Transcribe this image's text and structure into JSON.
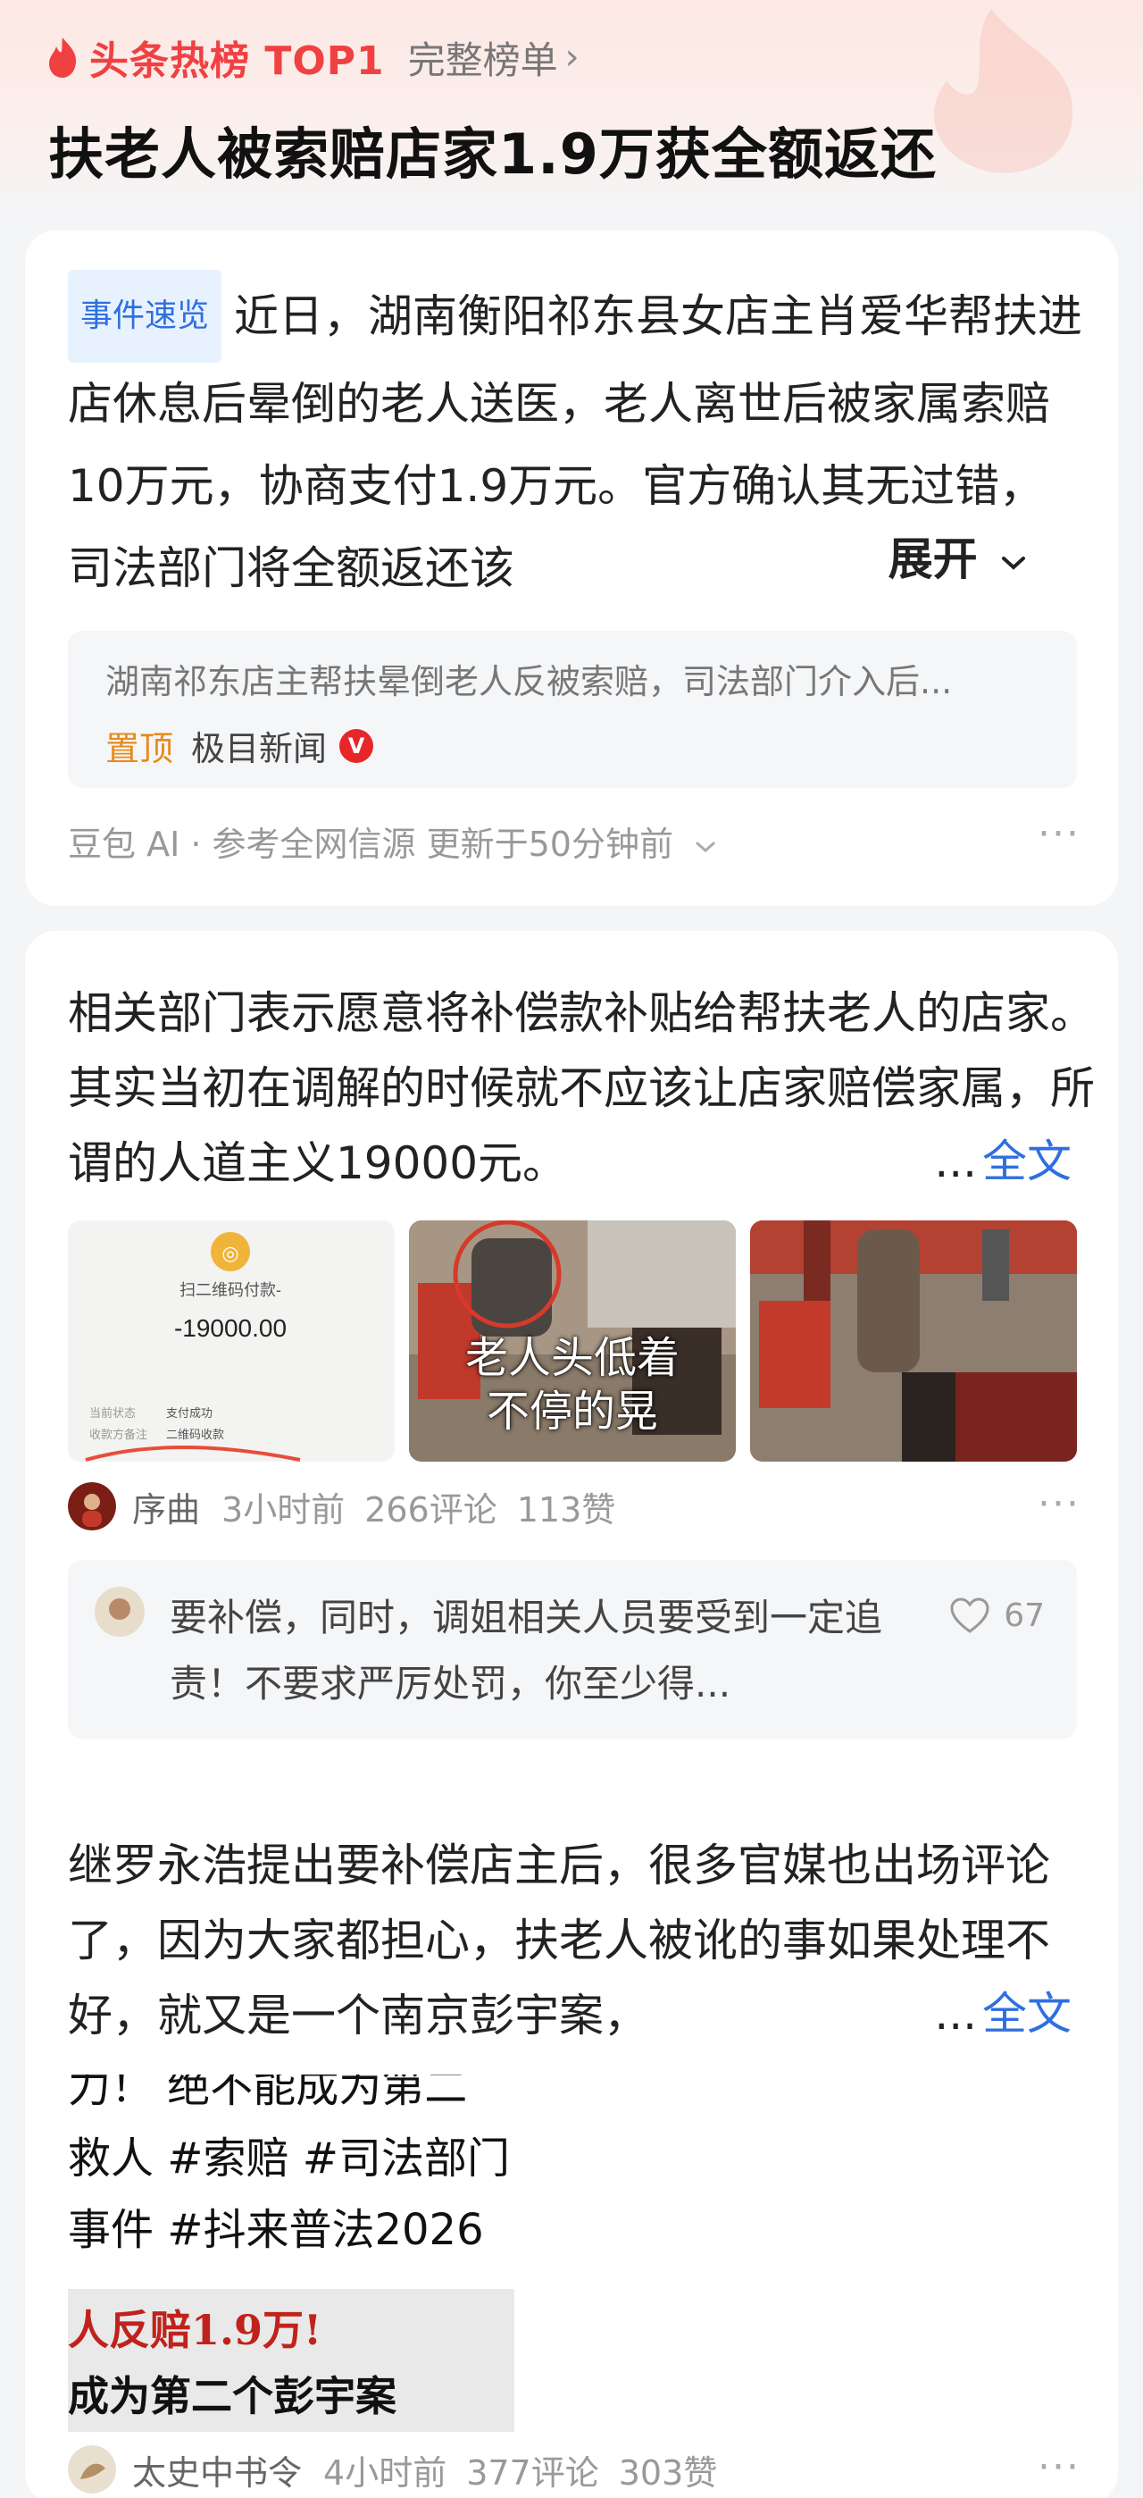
{
  "header": {
    "hot_label": "头条热榜 TOP1",
    "list_link": "完整榜单",
    "chevron": "›",
    "headline": "扶老人被索赔店家1.9万获全额返还"
  },
  "summary_card": {
    "tag": "事件速览",
    "text": "近日，湖南衡阳祁东县女店主肖爱华帮扶进店休息后晕倒的老人送医，老人离世后被家属索赔10万元，协商支付1.9万元。官方确认其无过错，司法部门将全额返还该",
    "expand": "展开",
    "expand_icon": "chevron-down",
    "source_title": "湖南祁东店主帮扶晕倒老人反被索赔，司法部门介入后...",
    "pinned": "置顶",
    "source_name": "极目新闻",
    "verified": "V",
    "ai_line": "豆包 AI · 参考全网信源 更新于50分钟前",
    "more": "···"
  },
  "post1": {
    "text": "相关部门表示愿意将补偿款补贴给帮扶老人的店家。 其实当初在调解的时候就不应该让店家赔偿家属，所谓的人道主义19000元。",
    "ellipsis": "...",
    "fulltext": "全文",
    "img1": {
      "title": "扫二维码付款-",
      "amount": "-19000.00",
      "row1_label": "当前状态",
      "row1_value": "支付成功",
      "row2_label": "收款方备注",
      "row2_value": "二维码收款"
    },
    "img2_caption_1": "老人头低着",
    "img2_caption_2": "不停的晃",
    "author": "序曲",
    "time": "3小时前",
    "comments": "266评论",
    "likes": "113赞",
    "more": "···",
    "comment_text": "要补偿，同时，调姐相关人员要受到一定追责！不要求严厉处罚，你至少得...",
    "comment_likes": "67"
  },
  "post2": {
    "text": "继罗永浩提出要补偿店主后，很多官媒也出场评论了，因为大家都担心，扶老人被讹的事如果处理不好，就又是一个南京彭宇案，",
    "ellipsis": "...",
    "fulltext": "全文",
    "img_line1": "力！ 绝不能成为第二",
    "img_line2": "救人 #索赔 #司法部门",
    "img_line3": "事件 #抖来普法2026",
    "img_banner1": "人反赔1.9万!",
    "img_banner2": "成为第二个彭宇案",
    "author": "太史中书令",
    "time": "4小时前",
    "comments": "377评论",
    "likes": "303赞",
    "more": "···"
  },
  "colors": {
    "accent_red": "#f04142",
    "link_blue": "#2f6fe0",
    "pin_orange": "#e88a1a"
  }
}
